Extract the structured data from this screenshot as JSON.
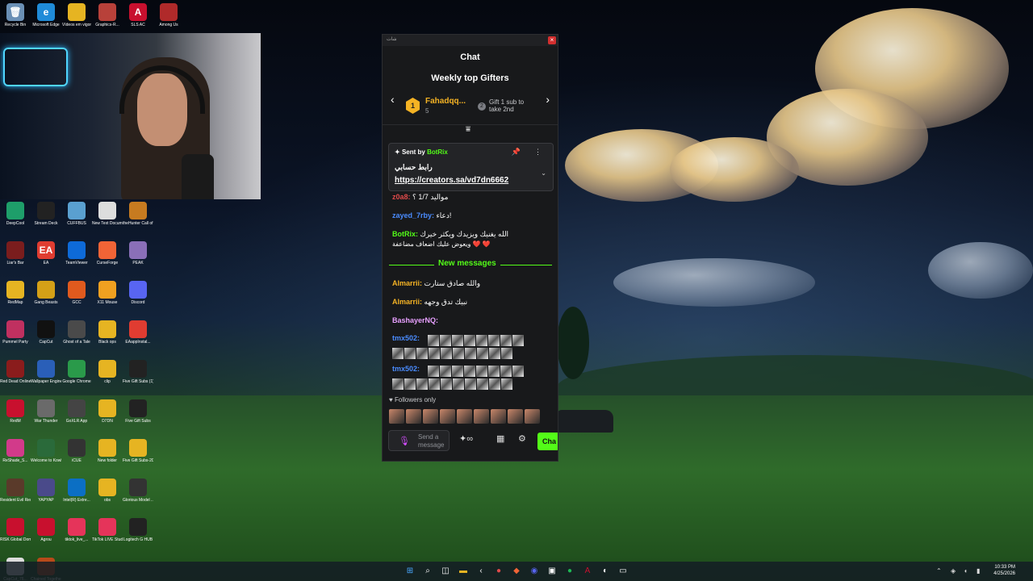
{
  "desktop": {
    "icons_top": [
      {
        "label": "Recycle Bin",
        "color": "#6a8fb5",
        "glyph": "🗑"
      },
      {
        "label": "Microsoft Edge",
        "color": "#1f8bd8",
        "glyph": "e"
      },
      {
        "label": "Vídeos em vigor",
        "color": "#e6b422",
        "glyph": ""
      },
      {
        "label": "Graphics-R...",
        "color": "#b8413a",
        "glyph": ""
      },
      {
        "label": "SLS AC",
        "color": "#c8102e",
        "glyph": "A"
      },
      {
        "label": "Among Us",
        "color": "#b02a2a",
        "glyph": ""
      }
    ],
    "icons_grid": [
      {
        "label": "DeepCool",
        "color": "#1e9e6a",
        "glyph": ""
      },
      {
        "label": "Stream Deck",
        "color": "#222",
        "glyph": ""
      },
      {
        "label": "CUFFBUS",
        "color": "#5aa0d0",
        "glyph": ""
      },
      {
        "label": "New Text Document",
        "color": "#ddd",
        "glyph": ""
      },
      {
        "label": "theHunter Call of t...",
        "color": "#c77b20",
        "glyph": ""
      },
      {
        "label": "Liar's Bar",
        "color": "#7a1d1d",
        "glyph": ""
      },
      {
        "label": "EA",
        "color": "#e03c31",
        "glyph": "EA"
      },
      {
        "label": "TeamViewer",
        "color": "#0e6ad8",
        "glyph": ""
      },
      {
        "label": "CurseForge",
        "color": "#f16436",
        "glyph": ""
      },
      {
        "label": "PEAK",
        "color": "#8a6fb8",
        "glyph": ""
      },
      {
        "label": "RedMap",
        "color": "#e6b422",
        "glyph": ""
      },
      {
        "label": "Gang Beasts",
        "color": "#d4a017",
        "glyph": ""
      },
      {
        "label": "GCC",
        "color": "#e05a1e",
        "glyph": ""
      },
      {
        "label": "X11 Mouse",
        "color": "#f0a020",
        "glyph": ""
      },
      {
        "label": "Discord",
        "color": "#5865f2",
        "glyph": ""
      },
      {
        "label": "Pummel Party",
        "color": "#c03060",
        "glyph": ""
      },
      {
        "label": "CapCut",
        "color": "#111",
        "glyph": ""
      },
      {
        "label": "Ghost of a Tale",
        "color": "#4a4a4a",
        "glyph": ""
      },
      {
        "label": "Black ops",
        "color": "#e6b422",
        "glyph": ""
      },
      {
        "label": "EAappInstal...",
        "color": "#e03c31",
        "glyph": ""
      },
      {
        "label": "Red Dead Online",
        "color": "#8a1c1c",
        "glyph": ""
      },
      {
        "label": "Wallpaper Engine",
        "color": "#2a5fb8",
        "glyph": ""
      },
      {
        "label": "Google Chrome",
        "color": "#2a9a4a",
        "glyph": ""
      },
      {
        "label": "clip",
        "color": "#e6b422",
        "glyph": ""
      },
      {
        "label": "Five Gift Subs (1)",
        "color": "#222",
        "glyph": ""
      },
      {
        "label": "RedM",
        "color": "#c8102e",
        "glyph": ""
      },
      {
        "label": "War Thunder",
        "color": "#6a6a6a",
        "glyph": ""
      },
      {
        "label": "GoXLR App",
        "color": "#444",
        "glyph": ""
      },
      {
        "label": "D7DN",
        "color": "#e6b422",
        "glyph": ""
      },
      {
        "label": "Five Gift Subs",
        "color": "#222",
        "glyph": ""
      },
      {
        "label": "ReShade_S...",
        "color": "#d23a8a",
        "glyph": ""
      },
      {
        "label": "Welcome to Kowloon",
        "color": "#2a6a3a",
        "glyph": ""
      },
      {
        "label": "iCUE",
        "color": "#333",
        "glyph": ""
      },
      {
        "label": "New folder",
        "color": "#e6b422",
        "glyph": ""
      },
      {
        "label": "Five Gift Subs-2025...",
        "color": "#e6b422",
        "glyph": ""
      },
      {
        "label": "Resident Evil Requiem",
        "color": "#5a3a2a",
        "glyph": ""
      },
      {
        "label": "YAPYAP",
        "color": "#4a4a8a",
        "glyph": ""
      },
      {
        "label": "Intel(R) Extre...",
        "color": "#0b6fc4",
        "glyph": ""
      },
      {
        "label": "obs",
        "color": "#e6b422",
        "glyph": ""
      },
      {
        "label": "Glorious Model ...",
        "color": "#333",
        "glyph": ""
      },
      {
        "label": "RISK Global Domination",
        "color": "#c8102e",
        "glyph": ""
      },
      {
        "label": "Agrou",
        "color": "#c8102e",
        "glyph": ""
      },
      {
        "label": "tiktok_live_...",
        "color": "#e5345a",
        "glyph": ""
      },
      {
        "label": "TikTok LIVE Studio",
        "color": "#e5345a",
        "glyph": ""
      },
      {
        "label": "Logitech G HUB",
        "color": "#222",
        "glyph": ""
      },
      {
        "label": "CapCut_76...",
        "color": "#ddd",
        "glyph": ""
      },
      {
        "label": "Chained Together",
        "color": "#b84a1a",
        "glyph": ""
      }
    ]
  },
  "chat": {
    "window_title": "شات",
    "close_glyph": "×",
    "header": "Chat",
    "gifters": {
      "title": "Weekly top Gifters",
      "prev_glyph": "‹",
      "next_glyph": "›",
      "rank1": "1",
      "name": "Fahadqq...",
      "count": "5",
      "rank2": "2",
      "tip": "Gift 1 sub to take 2nd"
    },
    "collapse_glyph": "⩸",
    "pinned": {
      "sent_by": "Sent by",
      "bot": "BotRix",
      "message": "رابط حسابي",
      "link": "https://creators.sa/vd7dn6662",
      "pin_glyph": "📌",
      "more_glyph": "⋮",
      "chevron_glyph": "⌄"
    },
    "messages": [
      {
        "user": "z0a8:",
        "user_color": "#e04a4a",
        "text": "موالید 1/7 ؟"
      },
      {
        "user": "zayed_7rby:",
        "user_color": "#4a8cff",
        "text": "دعاء!"
      },
      {
        "user": "BotRix:",
        "user_color": "#53fc18",
        "text": "الله يغنيك ويزيدك ويكثر خيرك"
      },
      {
        "user": "",
        "user_color": "#fff",
        "text": "ويعوض عليك اضعاف مضاعفة ❤️ ❤️"
      }
    ],
    "new_messages_label": "New messages",
    "messages_after": [
      {
        "user": "Almarrii:",
        "user_color": "#f5b324",
        "text": "والله صادق ستارت"
      },
      {
        "user": "Almarrii:",
        "user_color": "#f5b324",
        "text": "نبيك تدق وجهه"
      },
      {
        "user": "BashayerNQ:",
        "user_color": "#e8a0ff",
        "text": ""
      },
      {
        "user": "tmx502:",
        "user_color": "#4a8cff",
        "text": ""
      },
      {
        "user": "tmx502:",
        "user_color": "#4a8cff",
        "text": ""
      }
    ],
    "followers_only": "Followers only",
    "input_placeholder": "Send a message",
    "chat_button": "Cha"
  },
  "taskbar": {
    "time": "10:33 PM",
    "date": "4/25/2026"
  }
}
